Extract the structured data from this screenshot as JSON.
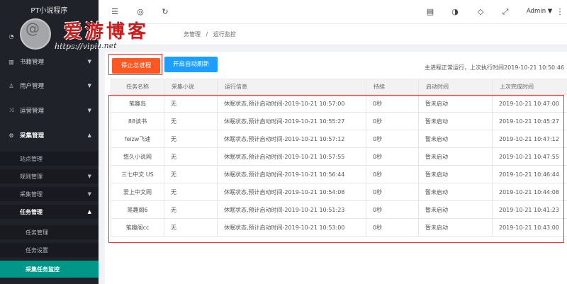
{
  "app": {
    "title": "PT小说程序"
  },
  "watermark": {
    "main": "爱游博客",
    "sub": "https://vipiu.net"
  },
  "sidebar": {
    "items": [
      {
        "label": "书籍管理",
        "icon": "book-icon",
        "arrow": "▼"
      },
      {
        "label": "用户管理",
        "icon": "user-icon",
        "arrow": "▼"
      },
      {
        "label": "运营管理",
        "icon": "operations-icon",
        "arrow": "▼"
      },
      {
        "label": "采集管理",
        "icon": "gear-icon",
        "arrow": "▲"
      }
    ],
    "sub_items": [
      {
        "label": "站点管理"
      },
      {
        "label": "规则管理",
        "arrow": "▼"
      },
      {
        "label": "采集管理",
        "arrow": "▼"
      },
      {
        "label": "任务管理",
        "arrow": "▲"
      },
      {
        "label": "任务管理"
      },
      {
        "label": "任务设置"
      },
      {
        "label": "采集任务监控"
      }
    ]
  },
  "header": {
    "user": "Admin"
  },
  "breadcrumb": {
    "partial": "务管理",
    "separator": "/",
    "current": "运行监控"
  },
  "toolbar": {
    "stop_label": "停止总进程",
    "auto_refresh_label": "开启自动刷新",
    "status_text": "主进程正常运行，上次执行时间2019-10-21 10:50:46"
  },
  "table": {
    "headers": [
      "任务名称",
      "采集小说",
      "运行信息",
      "持续",
      "启动时间",
      "上次完成时间"
    ],
    "rows": [
      [
        "笔趣岛",
        "无",
        "休眠状态,预计启动时间-2019-10-21 10:57:00",
        "0秒",
        "暂未启动",
        "2019-10-21 10:47:00"
      ],
      [
        "88读书",
        "无",
        "休眠状态,预计启动时间-2019-10-21 10:55:27",
        "0秒",
        "暂未启动",
        "2019-10-21 10:45:27"
      ],
      [
        "feizw飞速",
        "无",
        "休眠状态,预计启动时间-2019-10-21 10:57:12",
        "0秒",
        "暂未启动",
        "2019-10-21 10:47:12"
      ],
      [
        "悠久小说网",
        "无",
        "休眠状态,预计启动时间-2019-10-21 10:57:55",
        "0秒",
        "暂未启动",
        "2019-10-21 10:47:55"
      ],
      [
        "三七中文 US",
        "无",
        "休眠状态,预计启动时间-2019-10-21 10:56:44",
        "0秒",
        "暂未启动",
        "2019-10-21 10:46:44"
      ],
      [
        "爱上中文网",
        "无",
        "休眠状态,预计启动时间-2019-10-21 10:54:08",
        "0秒",
        "暂未启动",
        "2019-10-21 10:44:08"
      ],
      [
        "笔趣阁6",
        "无",
        "休眠状态,预计启动时间-2019-10-21 10:51:23",
        "0秒",
        "暂未启动",
        "2019-10-21 10:41:23"
      ],
      [
        "笔趣阁cc",
        "无",
        "休眠状态,预计启动时间-2019-10-21 10:53:00",
        "0秒",
        "暂未启动",
        "2019-10-21 10:43:00"
      ]
    ]
  },
  "colors": {
    "sidebar_bg": "#20222a",
    "active_teal": "#009688",
    "stop_orange": "#ff5722",
    "auto_blue": "#1e9fff",
    "highlight_red": "#e53935"
  }
}
